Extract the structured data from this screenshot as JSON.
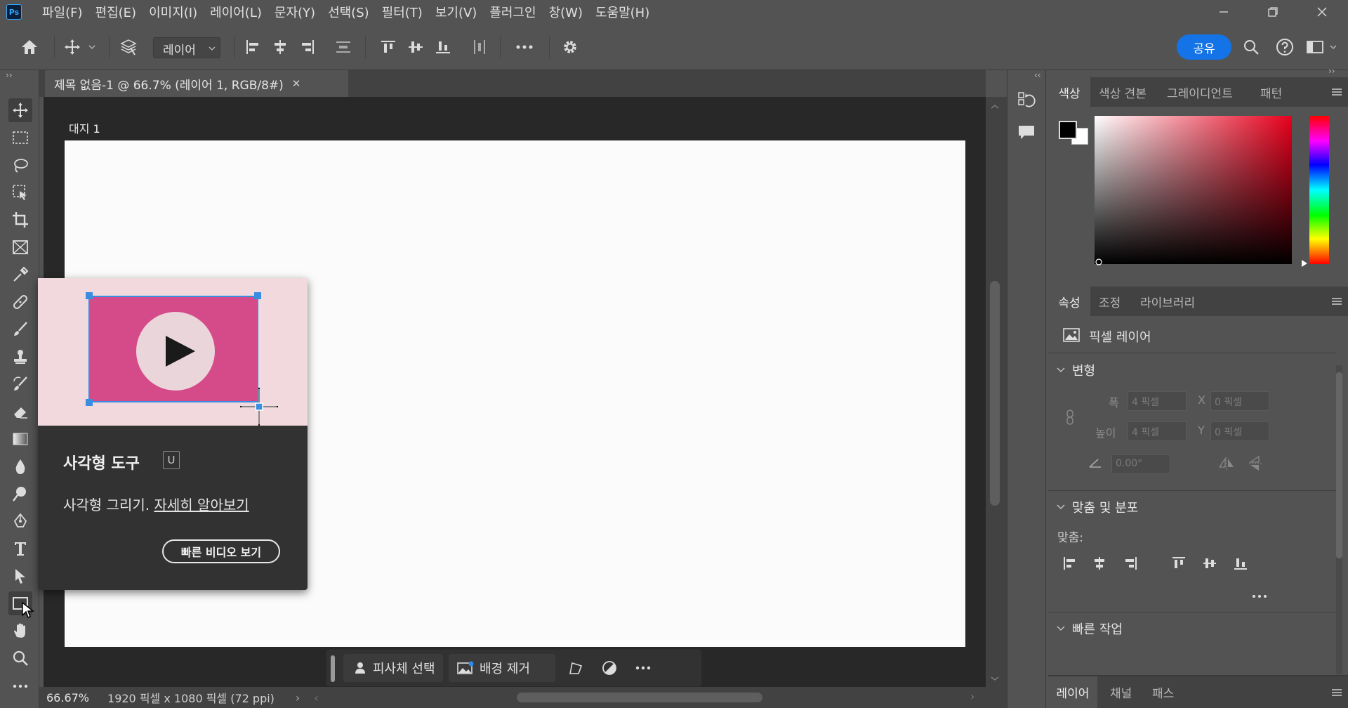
{
  "app": {
    "logo": "Ps"
  },
  "menu": [
    "파일(F)",
    "편집(E)",
    "이미지(I)",
    "레이어(L)",
    "문자(Y)",
    "선택(S)",
    "필터(T)",
    "보기(V)",
    "플러그인",
    "창(W)",
    "도움말(H)"
  ],
  "options": {
    "layer_select": "레이어",
    "share": "공유"
  },
  "document": {
    "tab_title": "제목 없음-1 @ 66.7% (레이어 1, RGB/8#)",
    "artboard_label": "대지 1"
  },
  "tooltip": {
    "title": "사각형 도구",
    "shortcut": "U",
    "desc": "사각형 그리기.",
    "link": "자세히 알아보기",
    "button": "빠른 비디오 보기"
  },
  "taskbar": {
    "select_subject": "피사체 선택",
    "remove_bg": "배경 제거"
  },
  "status": {
    "zoom": "66.67%",
    "doc_info": "1920 픽셀 x 1080 픽셀 (72 ppi)"
  },
  "color_panel": {
    "tabs": [
      "색상",
      "색상 견본",
      "그레이디언트",
      "패턴"
    ],
    "foreground": "#000000",
    "background": "#ffffff",
    "hue_color": "#e8001c"
  },
  "properties_panel": {
    "tabs": [
      "속성",
      "조정",
      "라이브러리"
    ],
    "layer_type": "픽셀 레이어",
    "transform": {
      "title": "변형",
      "w_label": "폭",
      "w_value": "4 픽셀",
      "x_label": "X",
      "x_value": "0 픽셀",
      "h_label": "높이",
      "h_value": "4 픽셀",
      "y_label": "Y",
      "y_value": "0 픽셀",
      "angle_value": "0.00°"
    },
    "align": {
      "title": "맞춤 및 분포",
      "label": "맞춤:"
    },
    "quick_actions": {
      "title": "빠른 작업"
    }
  },
  "layers_panel": {
    "tabs": [
      "레이어",
      "채널",
      "패스"
    ]
  }
}
